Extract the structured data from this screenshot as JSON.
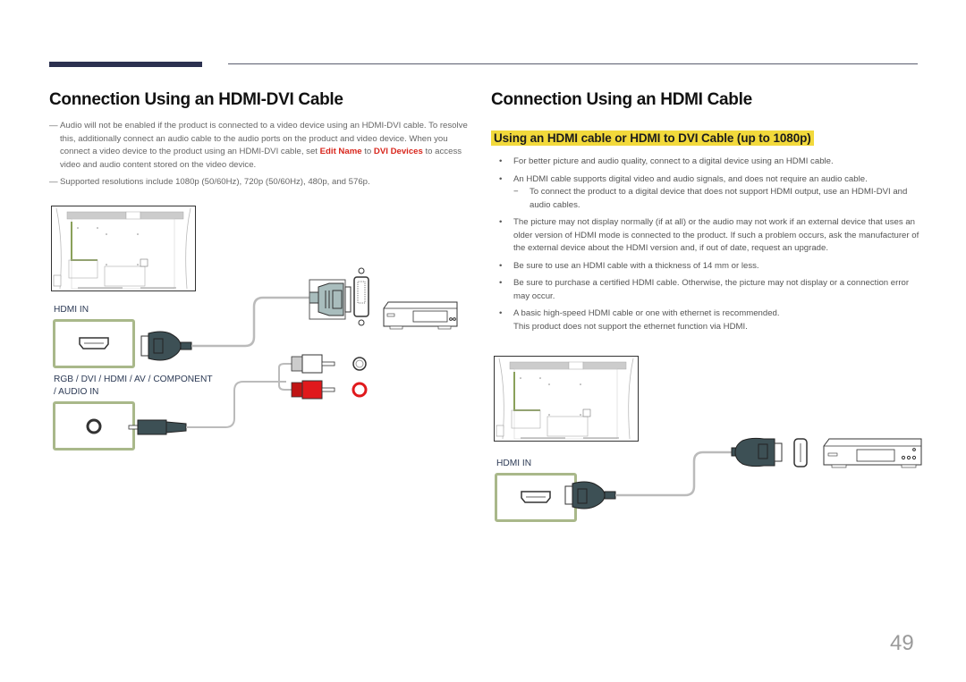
{
  "page": {
    "number": "49"
  },
  "left": {
    "title": "Connection Using an HDMI-DVI Cable",
    "notes": [
      {
        "dash": "—",
        "segments": [
          "Audio will not be enabled if the product is connected to a video device using an HDMI-DVI cable. To resolve this, additionally connect an audio cable to the audio ports on the product and video device. When you connect a video device to the product using an HDMI-DVI cable, set ",
          "Edit Name",
          " to ",
          "DVI Devices",
          " to access video and audio content stored on the video device."
        ]
      },
      {
        "dash": "—",
        "text": "Supported resolutions include 1080p (50/60Hz), 720p (50/60Hz), 480p, and 576p."
      }
    ],
    "diagram": {
      "hdmi_port_label": "HDMI IN",
      "audio_port_label_line1": "RGB / DVI / HDMI / AV / COMPONENT",
      "audio_port_label_line2": "/ AUDIO IN"
    }
  },
  "right": {
    "title": "Connection Using an HDMI Cable",
    "subheading": "Using an HDMI cable or HDMI to DVI Cable (up to 1080p)",
    "bullets": [
      {
        "bullet": "•",
        "text": "For better picture and audio quality, connect to a digital device using an HDMI cable."
      },
      {
        "bullet": "•",
        "text": "An HDMI cable supports digital video and audio signals, and does not require an audio cable.",
        "sub": {
          "bullet": "−",
          "text": "To connect the product to a digital device that does not support HDMI output, use an HDMI-DVI and audio cables."
        }
      },
      {
        "bullet": "•",
        "text": "The picture may not display normally (if at all) or the audio may not work if an external device that uses an older version of HDMI mode is connected to the product. If such a problem occurs, ask the manufacturer of the external device about the HDMI version and, if out of date, request an upgrade."
      },
      {
        "bullet": "•",
        "text": "Be sure to use an HDMI cable with a thickness of 14 mm or less."
      },
      {
        "bullet": "•",
        "text": "Be sure to purchase a certified HDMI cable. Otherwise, the picture may not display or a connection error may occur."
      },
      {
        "bullet": "•",
        "text": "A basic high-speed HDMI cable or one with ethernet is recommended.",
        "extra": "This product does not support the ethernet function via HDMI."
      }
    ],
    "diagram": {
      "hdmi_port_label": "HDMI IN"
    }
  },
  "colors": {
    "header_bar": "#2c3150",
    "highlight_bg": "#f2d93b",
    "emphasis_red": "#d8261c",
    "port_border": "#a9b88a",
    "connector_dark": "#3d5055",
    "audio_red": "#e0191c",
    "label_blue": "#2c3a55"
  }
}
